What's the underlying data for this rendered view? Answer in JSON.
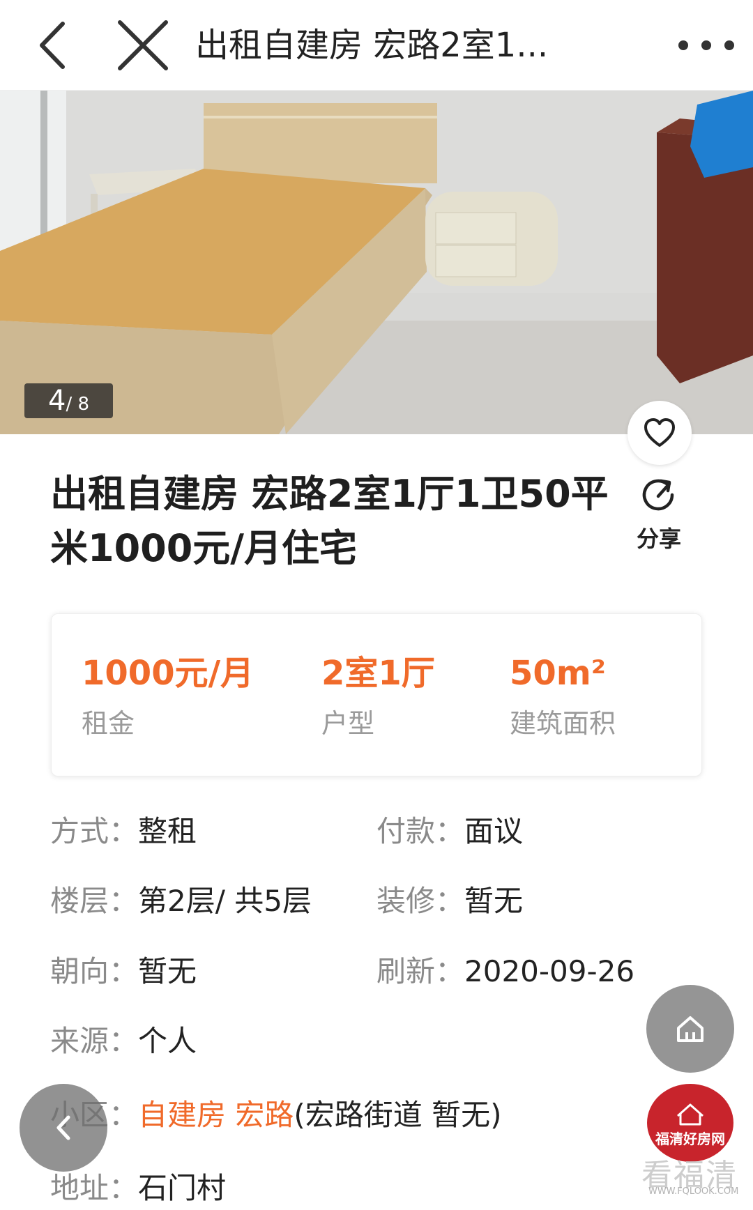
{
  "header": {
    "title": "出租自建房 宏路2室1...",
    "back_icon": "chevron-left-icon",
    "close_icon": "close-icon",
    "more_icon": "more-dots-icon"
  },
  "gallery": {
    "current": "4",
    "total": "/ 8"
  },
  "listing": {
    "title": "出租自建房 宏路2室1厅1卫50平米1000元/月住宅",
    "share_label": "分享"
  },
  "summary": [
    {
      "value": "1000元/月",
      "caption": "租金"
    },
    {
      "value": "2室1厅",
      "caption": "户型"
    },
    {
      "value": "50m²",
      "caption": "建筑面积"
    }
  ],
  "details": {
    "mode": {
      "key": "方式：",
      "value": "整租"
    },
    "payment": {
      "key": "付款：",
      "value": "面议"
    },
    "floor": {
      "key": "楼层：",
      "value": "第2层/ 共5层"
    },
    "decoration": {
      "key": "装修：",
      "value": "暂无"
    },
    "orientation": {
      "key": "朝向：",
      "value": "暂无"
    },
    "refresh": {
      "key": "刷新：",
      "value": "2020-09-26"
    },
    "source": {
      "key": "来源：",
      "value": "个人"
    },
    "community": {
      "key": "小区：",
      "link": "自建房 宏路",
      "extra": "(宏路街道 暂无)"
    },
    "address": {
      "key": "地址：",
      "value": "石门村"
    }
  },
  "branding": {
    "logo_text": "福清好房网",
    "watermark": "看福清",
    "watermark_url": "WWW.FQLOOK.COM"
  },
  "colors": {
    "accent": "#f06a2a",
    "label": "#8a8a8a",
    "brand_red": "#c8242c"
  }
}
